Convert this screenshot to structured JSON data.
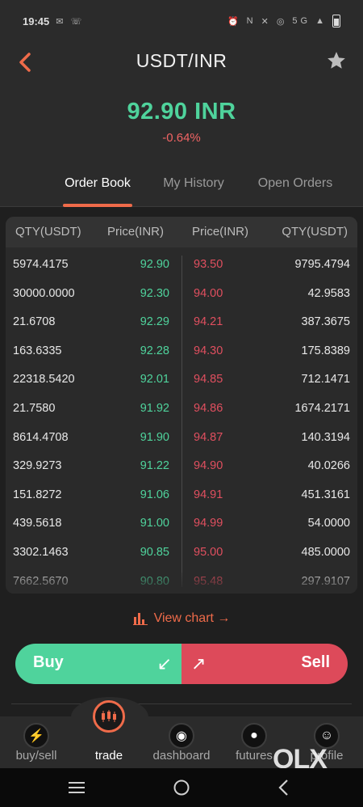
{
  "status_bar": {
    "time": "19:45",
    "left_icons": [
      "mail-icon",
      "wifi-calling-icon"
    ],
    "right_icons": [
      "alarm-icon",
      "nfc-icon",
      "mute-icon",
      "hotspot-icon",
      "5g-icon",
      "signal-icon",
      "battery-icon"
    ]
  },
  "header": {
    "title": "USDT/INR",
    "price": "92.90 INR",
    "change": "-0.64%",
    "price_color": "#4fd39c",
    "change_color": "#f06464",
    "accent": "#ef6b4a"
  },
  "tabs": [
    {
      "label": "Order Book",
      "active": true
    },
    {
      "label": "My History",
      "active": false
    },
    {
      "label": "Open Orders",
      "active": false
    }
  ],
  "order_book": {
    "headers": [
      "QTY(USDT)",
      "Price(INR)",
      "Price(INR)",
      "QTY(USDT)"
    ],
    "rows": [
      {
        "bid_qty": "5974.4175",
        "bid_price": "92.90",
        "ask_price": "93.50",
        "ask_qty": "9795.4794"
      },
      {
        "bid_qty": "30000.0000",
        "bid_price": "92.30",
        "ask_price": "94.00",
        "ask_qty": "42.9583"
      },
      {
        "bid_qty": "21.6708",
        "bid_price": "92.29",
        "ask_price": "94.21",
        "ask_qty": "387.3675"
      },
      {
        "bid_qty": "163.6335",
        "bid_price": "92.28",
        "ask_price": "94.30",
        "ask_qty": "175.8389"
      },
      {
        "bid_qty": "22318.5420",
        "bid_price": "92.01",
        "ask_price": "94.85",
        "ask_qty": "712.1471"
      },
      {
        "bid_qty": "21.7580",
        "bid_price": "91.92",
        "ask_price": "94.86",
        "ask_qty": "1674.2171"
      },
      {
        "bid_qty": "8614.4708",
        "bid_price": "91.90",
        "ask_price": "94.87",
        "ask_qty": "140.3194"
      },
      {
        "bid_qty": "329.9273",
        "bid_price": "91.22",
        "ask_price": "94.90",
        "ask_qty": "40.0266"
      },
      {
        "bid_qty": "151.8272",
        "bid_price": "91.06",
        "ask_price": "94.91",
        "ask_qty": "451.3161"
      },
      {
        "bid_qty": "439.5618",
        "bid_price": "91.00",
        "ask_price": "94.99",
        "ask_qty": "54.0000"
      },
      {
        "bid_qty": "3302.1463",
        "bid_price": "90.85",
        "ask_price": "95.00",
        "ask_qty": "485.0000"
      },
      {
        "bid_qty": "7662.5670",
        "bid_price": "90.80",
        "ask_price": "95.48",
        "ask_qty": "297.9107"
      }
    ]
  },
  "view_chart": {
    "label": "View chart →",
    "icon": "bar-chart-icon"
  },
  "actions": {
    "buy_label": "Buy",
    "sell_label": "Sell",
    "buy_color": "#4fd39c",
    "sell_color": "#dd4a5a",
    "buy_icon": "arrow-down-left-icon",
    "sell_icon": "arrow-up-right-icon"
  },
  "bottom_nav": [
    {
      "label": "buy/sell",
      "icon": "lightning-icon",
      "active": false
    },
    {
      "label": "trade",
      "icon": "candlestick-icon",
      "active": true
    },
    {
      "label": "dashboard",
      "icon": "dashboard-icon",
      "active": false
    },
    {
      "label": "futures",
      "icon": "futures-icon",
      "active": false
    },
    {
      "label": "profile",
      "icon": "profile-icon",
      "active": false
    }
  ],
  "watermark": "OLX",
  "system_nav": [
    "recents-icon",
    "home-icon",
    "back-icon"
  ]
}
